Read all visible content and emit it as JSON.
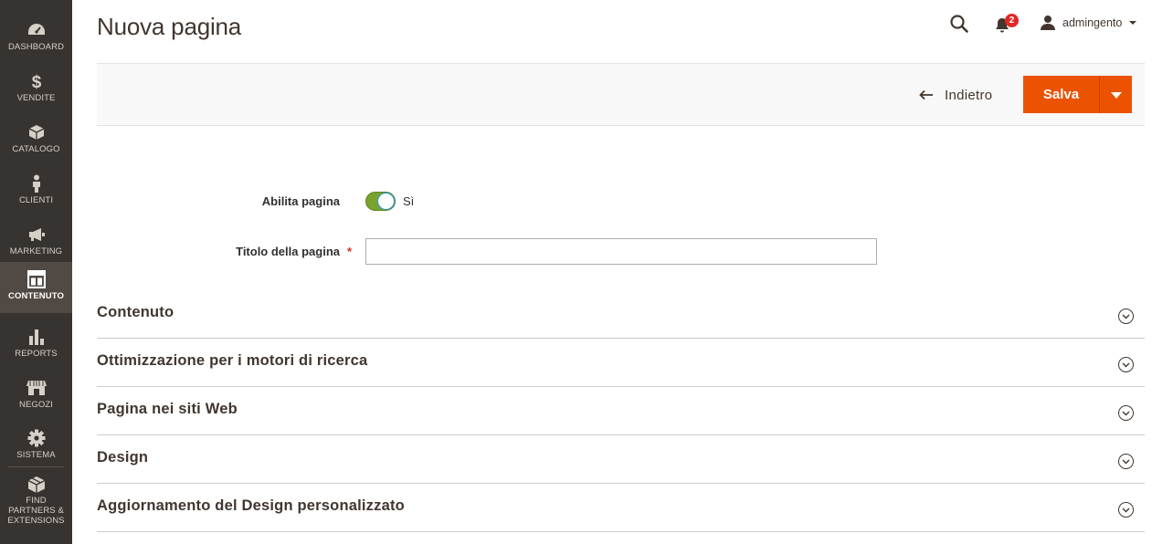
{
  "sidebar": {
    "items": [
      {
        "label": "DASHBOARD",
        "icon": "dashboard-icon"
      },
      {
        "label": "VENDITE",
        "icon": "dollar-icon"
      },
      {
        "label": "CATALOGO",
        "icon": "box-icon"
      },
      {
        "label": "CLIENTI",
        "icon": "person-icon"
      },
      {
        "label": "MARKETING",
        "icon": "megaphone-icon"
      },
      {
        "label": "CONTENUTO",
        "icon": "layout-icon",
        "active": true
      },
      {
        "label": "REPORTS",
        "icon": "bar-chart-icon"
      },
      {
        "label": "NEGOZI",
        "icon": "store-icon"
      },
      {
        "label": "SISTEMA",
        "icon": "gear-icon"
      },
      {
        "label": "FIND PARTNERS & EXTENSIONS",
        "icon": "cube-icon"
      }
    ]
  },
  "header": {
    "title": "Nuova pagina",
    "notification_count": "2",
    "username": "admingento"
  },
  "actions": {
    "back_label": "Indietro",
    "save_label": "Salva"
  },
  "form": {
    "enable_label": "Abilita pagina",
    "enable_value": "Sì",
    "title_label": "Titolo della pagina",
    "required_marker": "*",
    "title_value": ""
  },
  "sections": [
    {
      "title": "Contenuto"
    },
    {
      "title": "Ottimizzazione per i motori di ricerca"
    },
    {
      "title": "Pagina nei siti Web"
    },
    {
      "title": "Design"
    },
    {
      "title": "Aggiornamento del Design personalizzato"
    }
  ],
  "colors": {
    "sidebar_bg": "#373330",
    "sidebar_active": "#514943",
    "accent": "#eb5202",
    "toggle_on": "#79a22e",
    "badge": "#e22626"
  }
}
